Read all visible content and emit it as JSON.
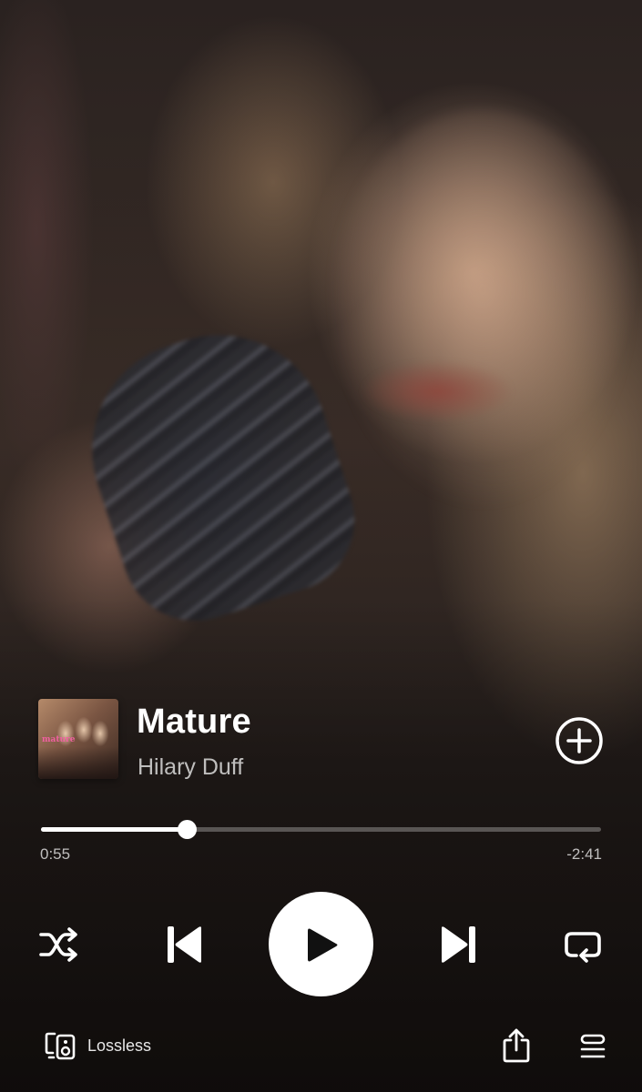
{
  "track": {
    "title": "Mature",
    "artist": "Hilary Duff",
    "cover_text": "mature"
  },
  "playback": {
    "elapsed": "0:55",
    "remaining": "-2:41",
    "progress_fraction": 0.2601,
    "state": "paused"
  },
  "bottom_bar": {
    "quality_label": "Lossless"
  },
  "icons": {
    "add": "plus-circle-icon",
    "shuffle": "shuffle-icon",
    "previous": "skip-previous-icon",
    "play": "play-icon",
    "next": "skip-next-icon",
    "repeat": "repeat-icon",
    "output": "speaker-device-icon",
    "share": "share-icon",
    "queue": "queue-icon"
  },
  "colors": {
    "primary": "#ffffff",
    "secondary_text": "rgba(255,255,255,0.72)",
    "progress_track": "rgba(255,255,255,0.28)"
  }
}
